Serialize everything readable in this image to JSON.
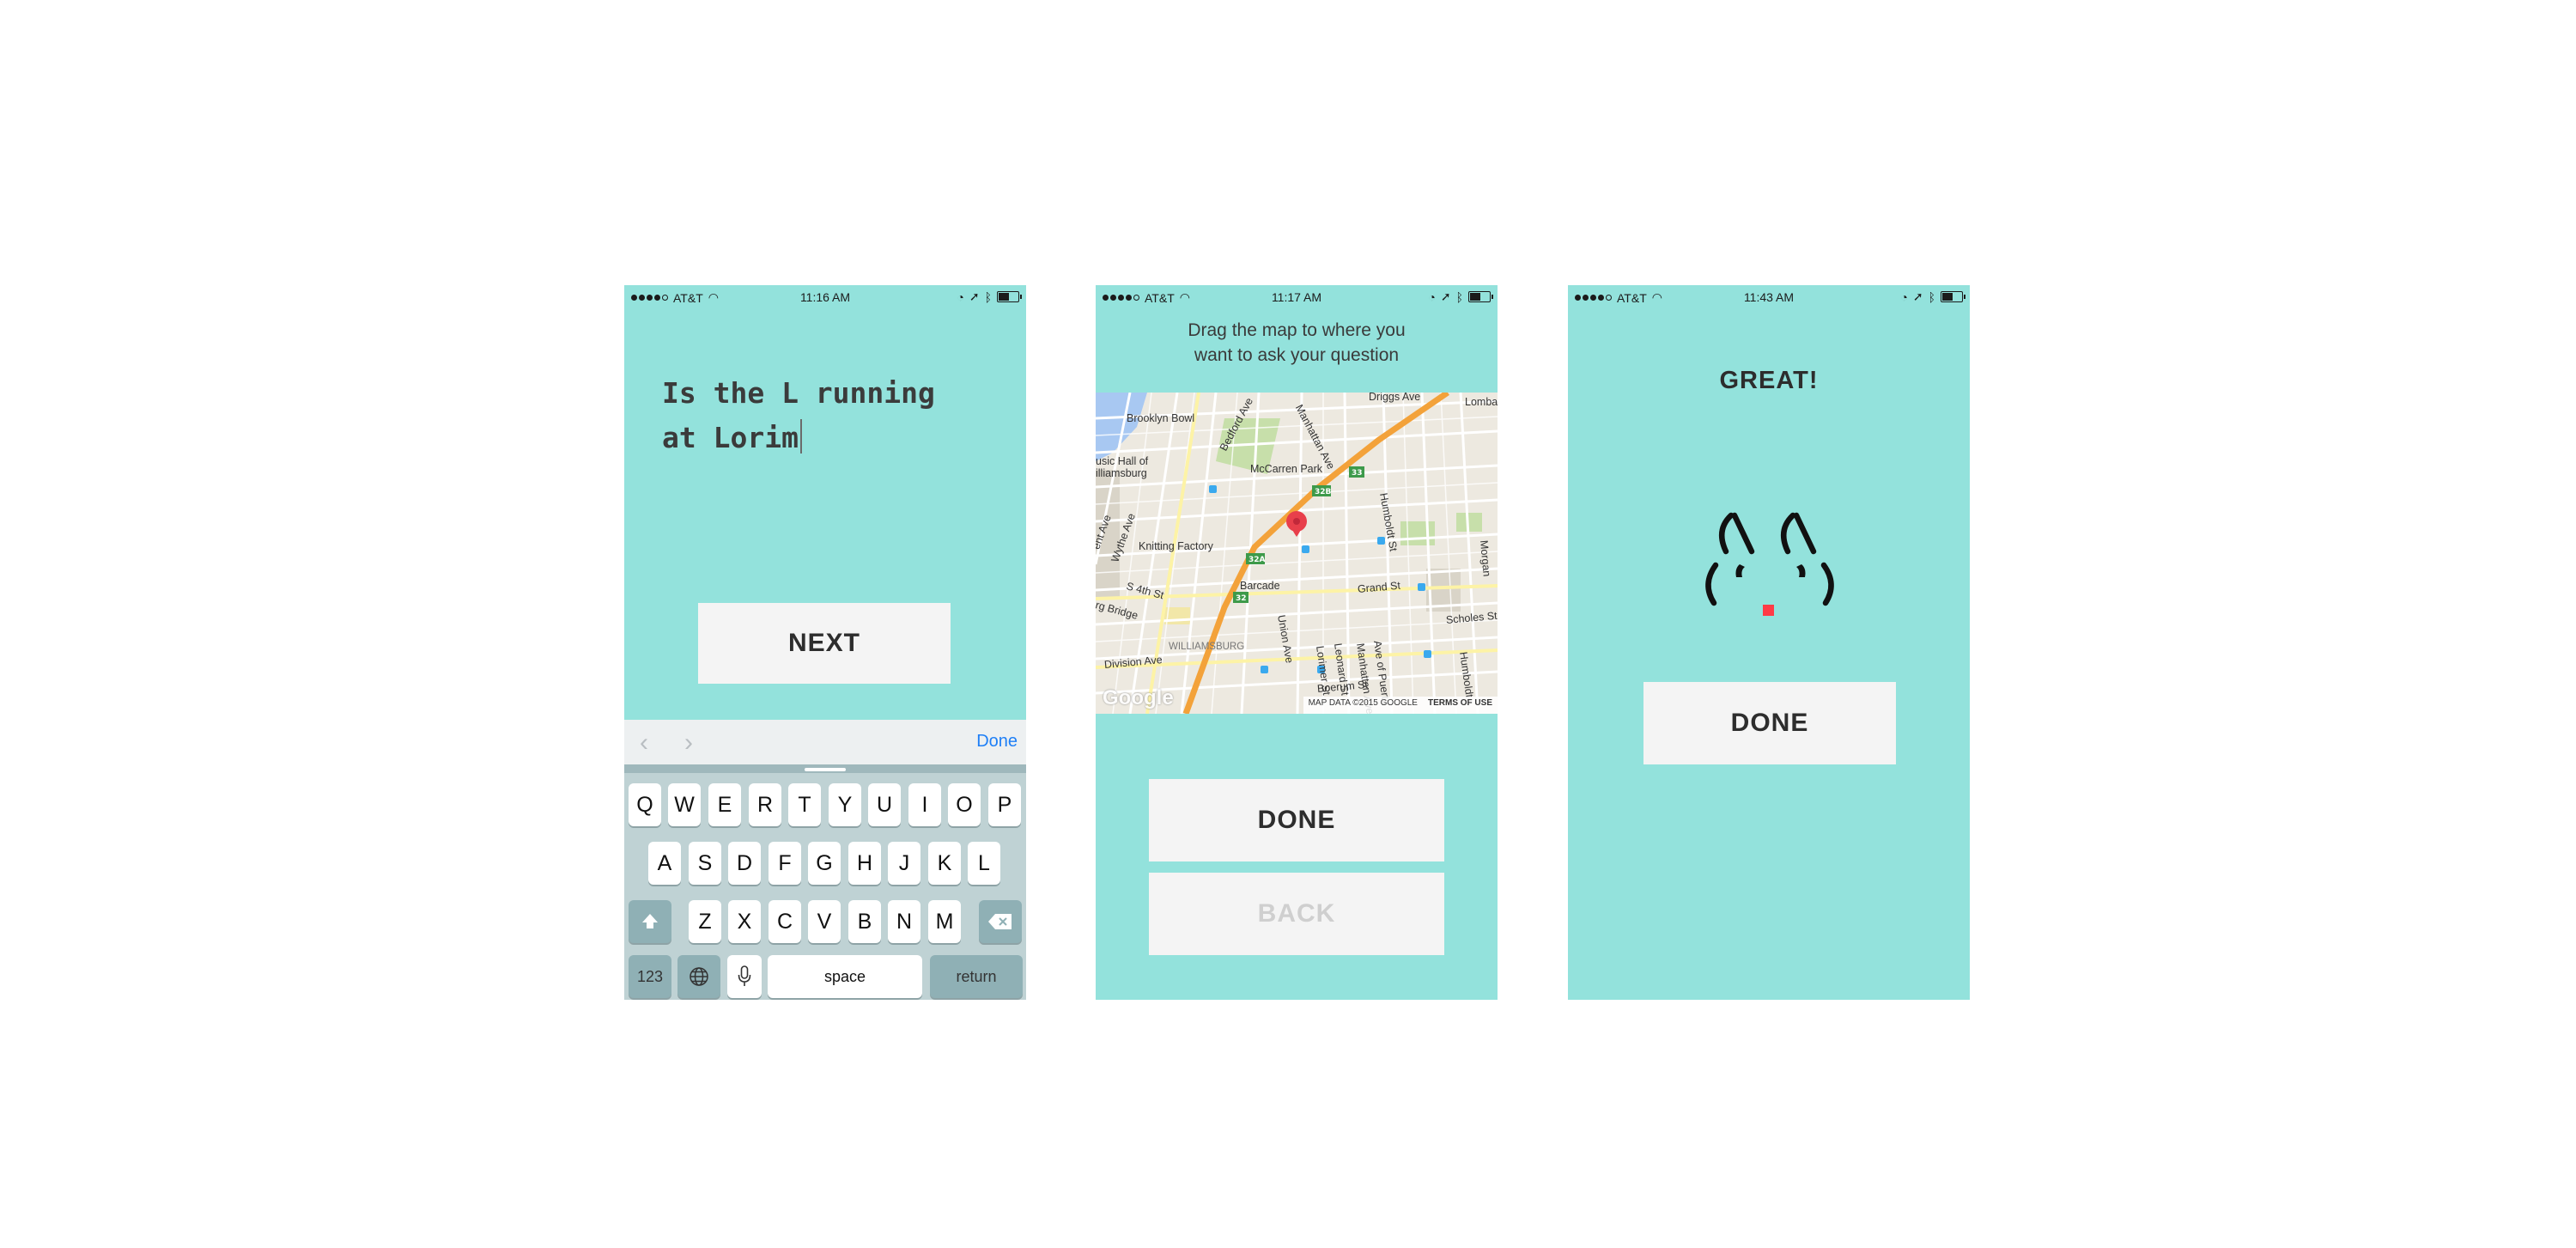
{
  "status_bars": [
    {
      "carrier": "AT&T",
      "time": "11:16 AM"
    },
    {
      "carrier": "AT&T",
      "time": "11:17 AM"
    },
    {
      "carrier": "AT&T",
      "time": "11:43 AM"
    }
  ],
  "screen1": {
    "question_line1": "Is the L running",
    "question_line2": "at Lorim",
    "next_label": "NEXT",
    "accessory_done": "Done",
    "keyboard": {
      "row1": [
        "Q",
        "W",
        "E",
        "R",
        "T",
        "Y",
        "U",
        "I",
        "O",
        "P"
      ],
      "row2": [
        "A",
        "S",
        "D",
        "F",
        "G",
        "H",
        "J",
        "K",
        "L"
      ],
      "row3": [
        "Z",
        "X",
        "C",
        "V",
        "B",
        "N",
        "M"
      ],
      "numbers_label": "123",
      "space_label": "space",
      "return_label": "return"
    }
  },
  "screen2": {
    "instruction_line1": "Drag the map to where you",
    "instruction_line2": "want to ask your question",
    "map": {
      "labels": [
        "Brooklyn Bowl",
        "Driggs Ave",
        "Manhattan Ave",
        "Bedford Ave",
        "McCarren Park",
        "usic Hall of",
        "illiamsburg",
        "Humboldt St",
        "Knitting Factory",
        "Wythe Ave",
        "ent Ave",
        "Morgan",
        "S 4th St",
        "rg Bridge",
        "Barcade",
        "Grand St",
        "Union Ave",
        "Leonard St",
        "Lorimer St",
        "Ave of Puerto",
        "Manhattan Ave",
        "Scholes St",
        "Humboldt",
        "WILLIAMSBURG",
        "Boerum St",
        "Division Ave",
        "Lombar"
      ],
      "shields": [
        "32B",
        "33",
        "32A",
        "32"
      ],
      "copyright": "MAP DATA ©2015 GOOGLE",
      "terms": "TERMS OF USE",
      "logo": "Google"
    },
    "done_label": "DONE",
    "back_label": "BACK"
  },
  "screen3": {
    "title": "GREAT!",
    "done_label": "DONE"
  },
  "colors": {
    "screen_bg": "#93e2dc",
    "button_bg": "#f4f4f4",
    "accent_red": "#ff3b46",
    "link_blue": "#1e7ff6"
  }
}
